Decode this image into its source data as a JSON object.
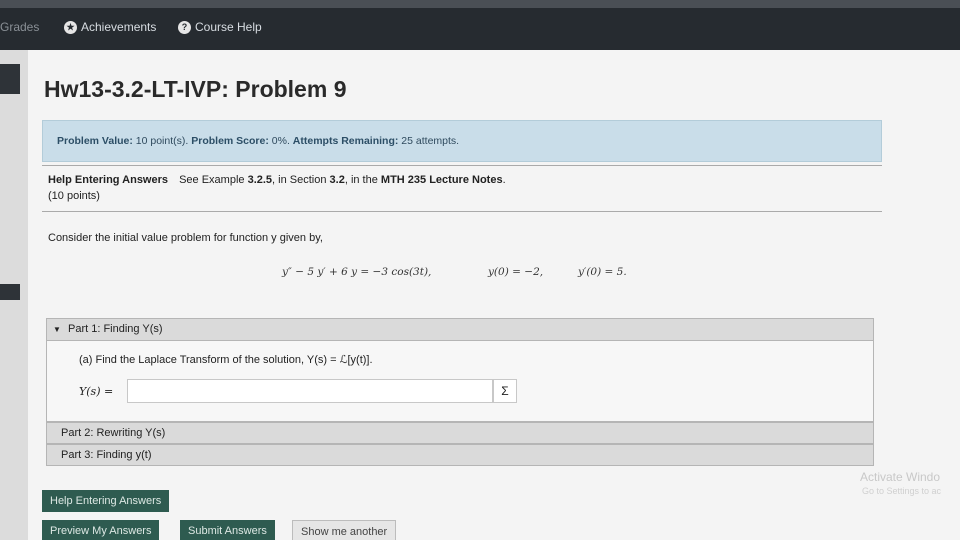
{
  "nav": {
    "grades": "Grades",
    "achievements": "Achievements",
    "course_help": "Course Help"
  },
  "problem": {
    "title": "Hw13-3.2-LT-IVP: Problem 9",
    "value_label": "Problem Value:",
    "value": "10 point(s).",
    "score_label": "Problem Score:",
    "score": "0%.",
    "attempts_label": "Attempts Remaining:",
    "attempts": "25 attempts."
  },
  "help": {
    "header": "Help Entering Answers",
    "text_pre": "See Example",
    "example": "3.2.5",
    "text_mid": ", in Section",
    "section": "3.2",
    "text_in": ", in the",
    "notes": "MTH 235 Lecture Notes",
    "text_end": ".",
    "points": "(10 points)"
  },
  "statement": {
    "text": "Consider the initial value problem for function y given by,",
    "ode": "y″ − 5 y′ + 6 y = −3 cos(3t),",
    "ic1": "y(0) = −2,",
    "ic2": "y′(0) = 5."
  },
  "parts": {
    "part1_title": "Part 1: Finding Y(s)",
    "part1_question": "(a) Find the Laplace Transform of the solution, Y(s) = ℒ[y(t)].",
    "answer_label": "Y(s) =",
    "answer_value": "",
    "sigma": "Σ",
    "part2_title": "Part 2: Rewriting Y(s)",
    "part3_title": "Part 3: Finding y(t)"
  },
  "buttons": {
    "help_entering": "Help Entering Answers",
    "preview": "Preview My Answers",
    "submit": "Submit Answers",
    "show_another": "Show me another"
  },
  "watermark": {
    "title": "Activate Windo",
    "sub": "Go to Settings to ac"
  }
}
